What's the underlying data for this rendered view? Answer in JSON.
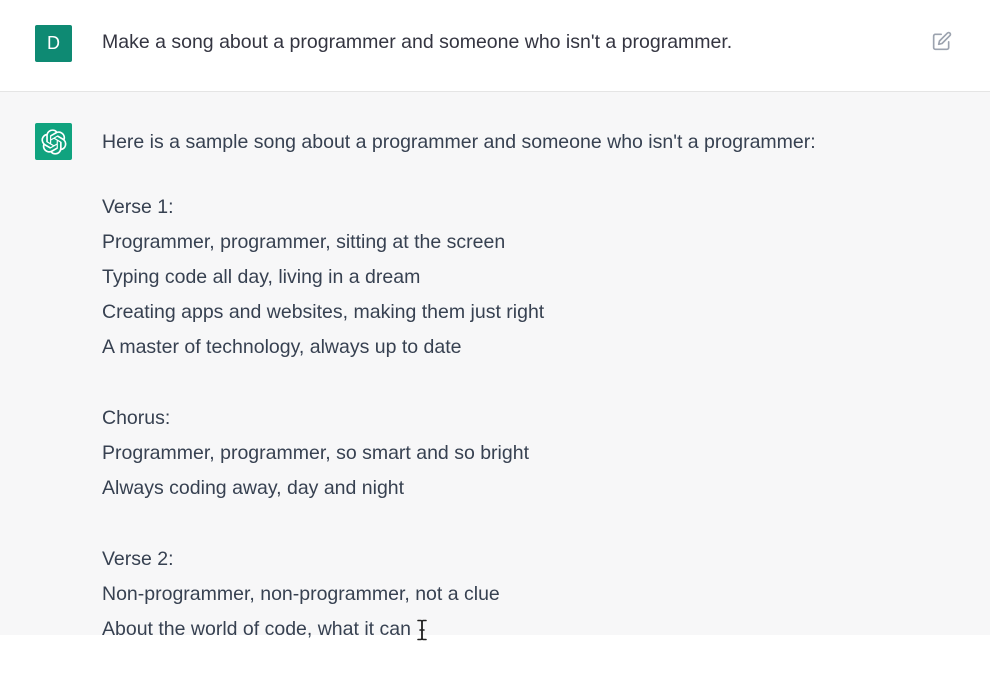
{
  "user": {
    "avatar_letter": "D",
    "message": "Make a song about a programmer and someone who isn't a programmer."
  },
  "assistant": {
    "intro": "Here is a sample song about a programmer and someone who isn't a programmer:",
    "stanzas": [
      {
        "heading": "Verse 1:",
        "lines": [
          "Programmer, programmer, sitting at the screen",
          "Typing code all day, living in a dream",
          "Creating apps and websites, making them just right",
          "A master of technology, always up to date"
        ]
      },
      {
        "heading": "Chorus:",
        "lines": [
          "Programmer, programmer, so smart and so bright",
          "Always coding away, day and night"
        ]
      },
      {
        "heading": "Verse 2:",
        "lines": [
          "Non-programmer, non-programmer, not a clue",
          "About the world of code, what it can"
        ]
      }
    ]
  },
  "icons": {
    "edit": "edit-icon",
    "bot": "openai-logo-icon",
    "cursor": "text-cursor-icon"
  },
  "colors": {
    "user_avatar": "#0e8a73",
    "bot_avatar": "#10a37f",
    "assistant_bg": "#f7f7f8",
    "text": "#374151"
  }
}
